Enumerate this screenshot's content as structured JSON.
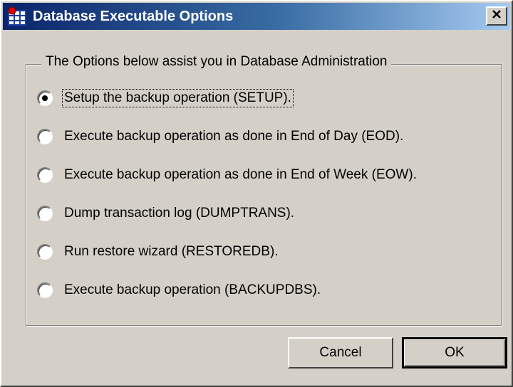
{
  "window": {
    "title": "Database Executable Options",
    "close_glyph": "×",
    "icons": {
      "app": "grid-app-icon",
      "close": "close-icon"
    }
  },
  "group": {
    "legend": "The Options below assist you in Database Administration"
  },
  "options": [
    {
      "label": "Setup the backup operation (SETUP).",
      "checked": true
    },
    {
      "label": "Execute backup operation as done in End of Day (EOD).",
      "checked": false
    },
    {
      "label": "Execute backup operation as done in End of Week (EOW).",
      "checked": false
    },
    {
      "label": "Dump transaction log (DUMPTRANS).",
      "checked": false
    },
    {
      "label": "Run restore wizard (RESTOREDB).",
      "checked": false
    },
    {
      "label": "Execute backup operation (BACKUPDBS).",
      "checked": false
    }
  ],
  "buttons": {
    "cancel": "Cancel",
    "ok": "OK"
  },
  "colors": {
    "face": "#d4d0c8",
    "title_start": "#0a246a",
    "title_end": "#a6caf0"
  }
}
